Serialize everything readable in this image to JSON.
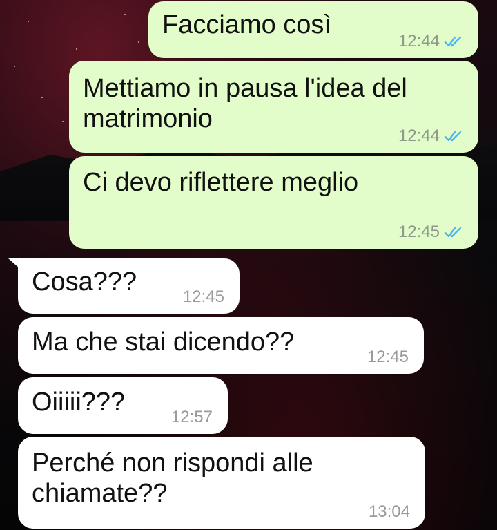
{
  "conversation": {
    "messages": [
      {
        "dir": "out",
        "text": "Facciamo così",
        "time": "12:44",
        "status_icon": "double-check-read-icon"
      },
      {
        "dir": "out",
        "text": "Mettiamo in pausa l'idea del matrimonio",
        "time": "12:44",
        "status_icon": "double-check-read-icon"
      },
      {
        "dir": "out",
        "text": "Ci devo riflettere meglio",
        "time": "12:45",
        "status_icon": "double-check-read-icon"
      },
      {
        "dir": "in",
        "text": "Cosa???",
        "time": "12:45"
      },
      {
        "dir": "in",
        "text": "Ma che stai dicendo??",
        "time": "12:45"
      },
      {
        "dir": "in",
        "text": "Oiiiii???",
        "time": "12:57"
      },
      {
        "dir": "in",
        "text": "Perché non rispondi alle chiamate??",
        "time": "13:04"
      }
    ]
  },
  "colors": {
    "outgoing_bubble": "#e2fdc9",
    "incoming_bubble": "#ffffff",
    "read_tick": "#4fb3f6"
  }
}
